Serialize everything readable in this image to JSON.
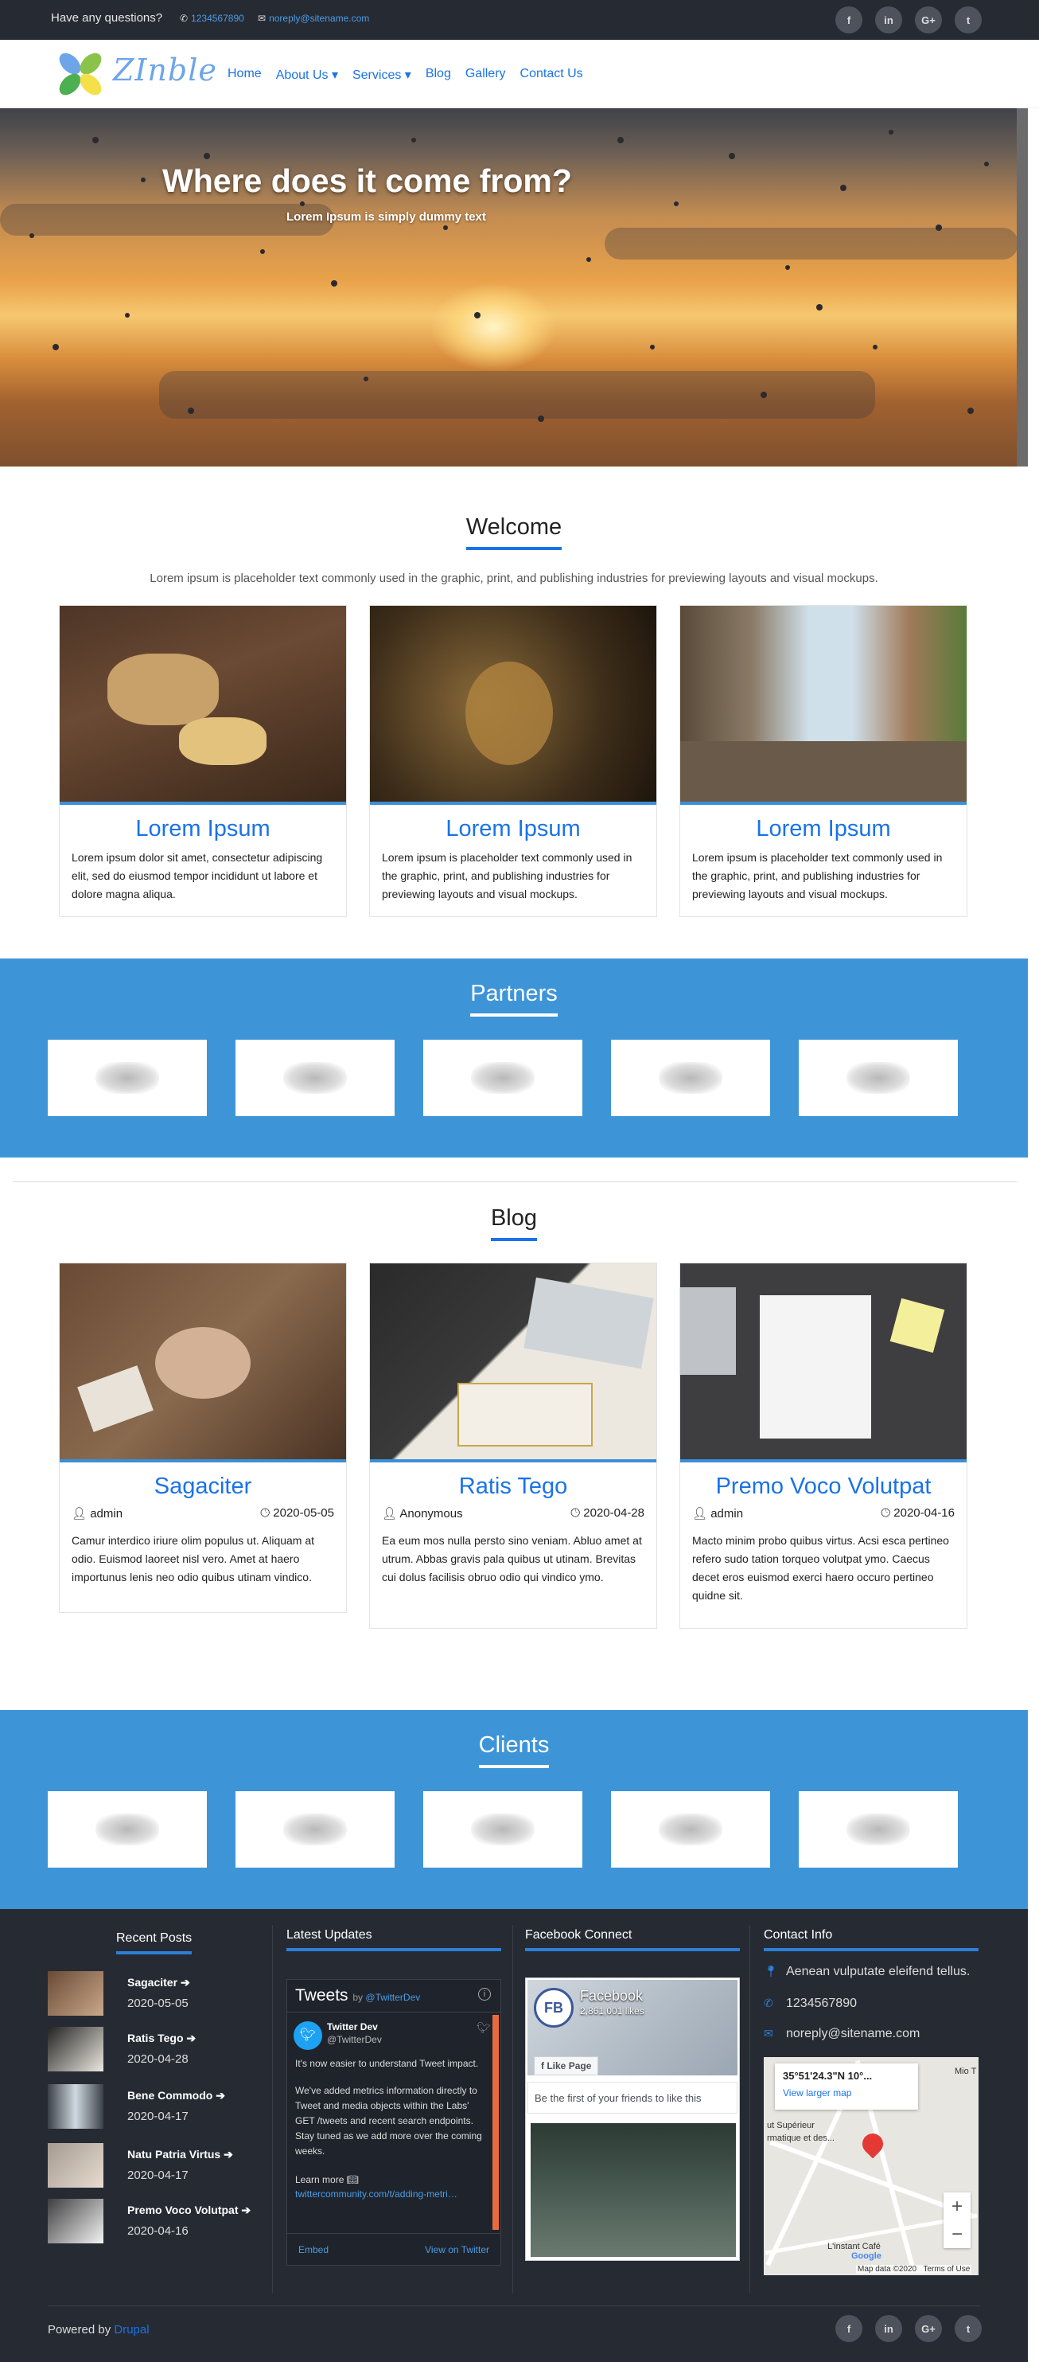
{
  "topbar": {
    "question": "Have any questions?",
    "phone": "1234567890",
    "email": "noreply@sitename.com",
    "social": [
      "f",
      "in",
      "G+",
      "t"
    ]
  },
  "navbar": {
    "logo_text": "ZInble",
    "menu": [
      "Home",
      "About Us ▾",
      "Services ▾",
      "Blog",
      "Gallery",
      "Contact Us"
    ]
  },
  "hero": {
    "title": "Where does it come from?",
    "subtitle": "Lorem Ipsum is simply dummy text"
  },
  "welcome": {
    "title": "Welcome",
    "lead": "Lorem ipsum is placeholder text commonly used in the graphic, print, and publishing industries for previewing layouts and visual mockups.",
    "cards": [
      {
        "title": "Lorem Ipsum",
        "text": "Lorem ipsum dolor sit amet, consectetur adipiscing elit, sed do eiusmod tempor incididunt ut labore et dolore magna aliqua."
      },
      {
        "title": "Lorem Ipsum",
        "text": "Lorem ipsum is placeholder text commonly used in the graphic, print, and publishing industries for previewing layouts and visual mockups."
      },
      {
        "title": "Lorem Ipsum",
        "text": "Lorem ipsum is placeholder text commonly used in the graphic, print, and publishing industries for previewing layouts and visual mockups."
      }
    ]
  },
  "partners": {
    "title": "Partners"
  },
  "blog": {
    "title": "Blog",
    "posts": [
      {
        "title": "Sagaciter",
        "author": "admin",
        "date": "2020-05-05",
        "text": "Camur interdico iriure olim populus ut. Aliquam at odio. Euismod laoreet nisl vero. Amet at haero importunus lenis neo odio quibus utinam vindico."
      },
      {
        "title": "Ratis Tego",
        "author": "Anonymous",
        "date": "2020-04-28",
        "text": "Ea eum mos nulla persto sino veniam. Abluo amet at utrum. Abbas gravis pala quibus ut utinam. Brevitas cui dolus facilisis obruo odio qui vindico ymo."
      },
      {
        "title": "Premo Voco Volutpat",
        "author": "admin",
        "date": "2020-04-16",
        "text": "Macto minim probo quibus virtus. Acsi esca pertineo refero sudo tation torqueo volutpat ymo. Caecus decet eros euismod exerci haero occuro pertineo quidne sit."
      }
    ]
  },
  "clients": {
    "title": "Clients"
  },
  "footer": {
    "recent_title": "Recent Posts",
    "recent": [
      {
        "title": "Sagaciter",
        "date": "2020-05-05"
      },
      {
        "title": "Ratis Tego",
        "date": "2020-04-28"
      },
      {
        "title": "Bene Commodo",
        "date": "2020-04-17"
      },
      {
        "title": "Natu Patria Virtus",
        "date": "2020-04-17"
      },
      {
        "title": "Premo Voco Volutpat",
        "date": "2020-04-16"
      }
    ],
    "updates_title": "Latest Updates",
    "twitter": {
      "heading": "Tweets",
      "by": "by",
      "by_handle": "@TwitterDev",
      "name": "Twitter Dev",
      "handle": "@TwitterDev",
      "text1": "It's now easier to understand Tweet impact.",
      "text2": "We've added metrics information directly to Tweet and media objects within the Labs' GET /tweets and recent search endpoints. Stay tuned as we add more over the coming weeks.",
      "learn": "Learn more",
      "link": "twittercommunity.com/t/adding-metri…",
      "embed": "Embed",
      "view": "View on Twitter"
    },
    "facebook_title": "Facebook Connect",
    "facebook": {
      "name": "Facebook",
      "likes": "2,861,001 likes",
      "like_button": "Like Page",
      "friends": "Be the first of your friends to like this"
    },
    "contact_title": "Contact Info",
    "contact": {
      "address": "Aenean vulputate eleifend tellus.",
      "phone": "1234567890",
      "email": "noreply@sitename.com"
    },
    "map": {
      "coords": "35°51'24.3\"N 10°...",
      "link": "View larger map",
      "label1": "ut Supérieur",
      "label2": "rmatique et des...",
      "label3": "L'instant Café",
      "data": "Map data ©2020",
      "terms": "Terms of Use",
      "mio": "Mio T",
      "google": "Google"
    },
    "powered_prefix": "Powered by",
    "powered_link": "Drupal",
    "social": [
      "f",
      "in",
      "G+",
      "t"
    ]
  }
}
